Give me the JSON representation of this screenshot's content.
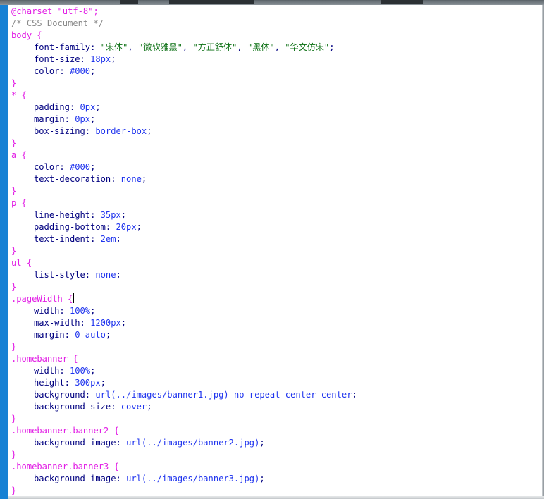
{
  "editor": {
    "lines": [
      {
        "kind": "selector",
        "text": "@charset \"utf-8\";"
      },
      {
        "kind": "comment",
        "text": "/* CSS Document */"
      },
      {
        "kind": "selector",
        "text": "body {"
      },
      {
        "kind": "fontfamily",
        "prop": "font-family:",
        "fonts": [
          "\"宋体\"",
          "\"微软雅黑\"",
          "\"方正舒体\"",
          "\"黑体\"",
          "\"华文仿宋\""
        ]
      },
      {
        "kind": "decl",
        "prop": "font-size:",
        "value": "18px"
      },
      {
        "kind": "decl",
        "prop": "color:",
        "value": "#000"
      },
      {
        "kind": "close",
        "text": "}"
      },
      {
        "kind": "selector",
        "text": "* {"
      },
      {
        "kind": "decl",
        "prop": "padding:",
        "value": "0px"
      },
      {
        "kind": "decl",
        "prop": "margin:",
        "value": "0px"
      },
      {
        "kind": "decl",
        "prop": "box-sizing:",
        "value": "border-box"
      },
      {
        "kind": "close",
        "text": "}"
      },
      {
        "kind": "selector",
        "text": "a {"
      },
      {
        "kind": "decl",
        "prop": "color:",
        "value": "#000"
      },
      {
        "kind": "decl",
        "prop": "text-decoration:",
        "value": "none"
      },
      {
        "kind": "close",
        "text": "}"
      },
      {
        "kind": "selector",
        "text": "p {"
      },
      {
        "kind": "decl",
        "prop": "line-height:",
        "value": "35px"
      },
      {
        "kind": "decl",
        "prop": "padding-bottom:",
        "value": "20px"
      },
      {
        "kind": "decl",
        "prop": "text-indent:",
        "value": "2em"
      },
      {
        "kind": "close",
        "text": "}"
      },
      {
        "kind": "selector",
        "text": "ul {"
      },
      {
        "kind": "decl",
        "prop": "list-style:",
        "value": "none"
      },
      {
        "kind": "close",
        "text": "}"
      },
      {
        "kind": "selector_caret",
        "text": ".pageWidth {"
      },
      {
        "kind": "decl",
        "prop": "width:",
        "value": "100%"
      },
      {
        "kind": "decl",
        "prop": "max-width:",
        "value": "1200px"
      },
      {
        "kind": "decl",
        "prop": "margin:",
        "value": "0 auto"
      },
      {
        "kind": "close",
        "text": "}"
      },
      {
        "kind": "selector",
        "text": ".homebanner {"
      },
      {
        "kind": "decl",
        "prop": "width:",
        "value": "100%"
      },
      {
        "kind": "decl",
        "prop": "height:",
        "value": "300px"
      },
      {
        "kind": "decl",
        "prop": "background:",
        "value": "url(../images/banner1.jpg) no-repeat center center"
      },
      {
        "kind": "decl",
        "prop": "background-size:",
        "value": "cover"
      },
      {
        "kind": "close",
        "text": "}"
      },
      {
        "kind": "selector",
        "text": ".homebanner.banner2 {"
      },
      {
        "kind": "decl",
        "prop": "background-image:",
        "value": "url(../images/banner2.jpg)"
      },
      {
        "kind": "close",
        "text": "}"
      },
      {
        "kind": "selector",
        "text": ".homebanner.banner3 {"
      },
      {
        "kind": "decl",
        "prop": "background-image:",
        "value": "url(../images/banner3.jpg)"
      },
      {
        "kind": "close",
        "text": "}"
      }
    ],
    "colors": {
      "selector": "#e21fe5",
      "comment": "#8a8a8a",
      "property": "#000080",
      "value": "#1f34ee",
      "string": "#0a6f12",
      "gutter": "#1781d4"
    }
  }
}
